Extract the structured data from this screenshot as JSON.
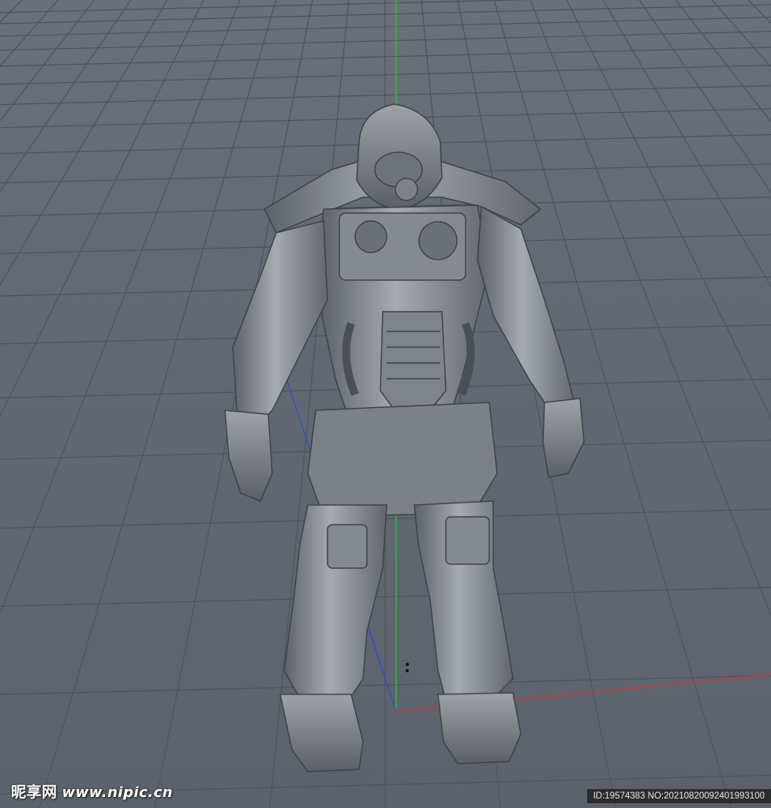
{
  "viewport": {
    "background": "#616871",
    "grid_color": "#4d545d",
    "axis_colors": {
      "x": "#c8393a",
      "y": "#34b24a",
      "z": "#3a4ad0"
    }
  },
  "model": {
    "color": "#8d9298",
    "shadow": "#4a4f55",
    "highlight": "#b4b8bd"
  },
  "watermark": {
    "logo_text": "昵享网",
    "url_text": "www.nipic.cn",
    "id_text": "ID:19574383 NO:20210820092401993100"
  }
}
